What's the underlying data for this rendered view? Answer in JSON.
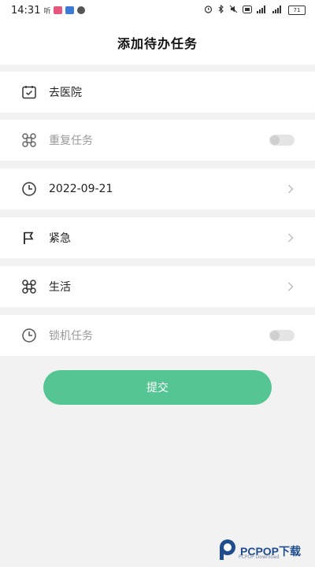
{
  "status_bar": {
    "time": "14:31",
    "left_glyph": "听",
    "right_text": "",
    "battery": "71"
  },
  "header": {
    "title": "添加待办任务"
  },
  "rows": [
    {
      "icon": "calendar-icon",
      "label": "去医院",
      "muted": false,
      "control": "none"
    },
    {
      "icon": "repeat-icon",
      "label": "重复任务",
      "muted": true,
      "control": "toggle",
      "on": false
    },
    {
      "icon": "clock-icon",
      "label": "2022-09-21",
      "muted": false,
      "control": "chevron"
    },
    {
      "icon": "flag-icon",
      "label": "紧急",
      "muted": false,
      "control": "chevron"
    },
    {
      "icon": "category-icon",
      "label": "生活",
      "muted": false,
      "control": "chevron"
    },
    {
      "icon": "clock-icon",
      "label": "锁机任务",
      "muted": true,
      "control": "toggle",
      "on": false
    }
  ],
  "submit": {
    "label": "提交"
  },
  "watermark": {
    "text": "PCPOP下载",
    "sub": "PCPOP Download"
  },
  "colors": {
    "accent": "#55c593",
    "background": "#f2f2f2",
    "row": "#ffffff",
    "watermark": "#1f4d8e"
  }
}
